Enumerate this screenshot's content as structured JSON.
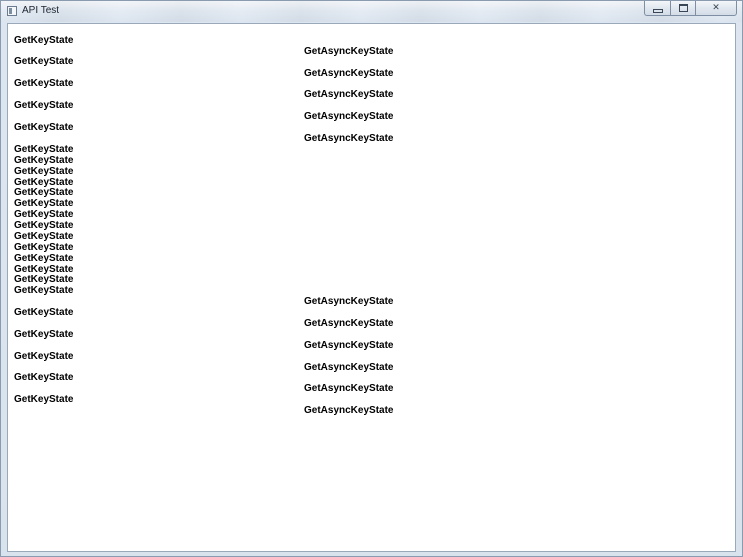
{
  "window": {
    "title": "API Test",
    "minimize_glyph": "minimize-icon",
    "maximize_glyph": "maximize-icon",
    "close_glyph": "✕"
  },
  "output": {
    "key_state_lines": [
      "GetKeyState",
      "GetKeyState",
      "GetKeyState",
      "GetKeyState",
      "GetKeyState",
      "GetKeyState",
      "GetKeyState",
      "GetKeyState",
      "GetKeyState",
      "GetKeyState",
      "GetKeyState",
      "GetKeyState",
      "GetKeyState",
      "GetKeyState",
      "GetKeyState",
      "GetKeyState",
      "GetKeyState",
      "GetKeyState",
      "GetKeyState",
      "GetKeyState",
      "GetKeyState",
      "GetKeyState",
      "GetKeyState",
      "GetKeyState",
      "GetKeyState"
    ],
    "async_key_state_lines": [
      "GetAsyncKeyState",
      "GetAsyncKeyState",
      "GetAsyncKeyState",
      "GetAsyncKeyState",
      "GetAsyncKeyState",
      "GetAsyncKeyState",
      "GetAsyncKeyState",
      "GetAsyncKeyState",
      "GetAsyncKeyState",
      "GetAsyncKeyState",
      "GetAsyncKeyState"
    ]
  }
}
